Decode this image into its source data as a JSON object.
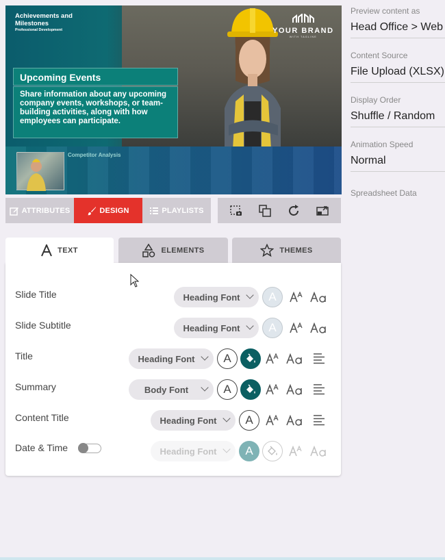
{
  "preview": {
    "header_title": "Achievements and Milestones",
    "header_subtitle": "Professional Development",
    "brand_name": "YOUR BRAND",
    "brand_tagline": "WITH TAGLINE",
    "event_title": "Upcoming Events",
    "event_body": "Share information about any upcoming company events, workshops, or team-building activities, along with how employees can participate.",
    "thumb_label": "Competitor Analysis"
  },
  "settings": {
    "preview_label": "Preview content as",
    "preview_value": "Head Office > Web",
    "source_label": "Content Source",
    "source_value": "File Upload (XLSX)",
    "order_label": "Display Order",
    "order_value": "Shuffle / Random",
    "speed_label": "Animation Speed",
    "speed_value": "Normal",
    "spreadsheet_label": "Spreadsheet Data"
  },
  "toolbar": {
    "attributes": "ATTRIBUTES",
    "design": "DESIGN",
    "playlists": "PLAYLISTS"
  },
  "tabs": {
    "text": "TEXT",
    "elements": "ELEMENTS",
    "themes": "THEMES"
  },
  "rows": {
    "slide_title": {
      "label": "Slide Title",
      "font": "Heading Font"
    },
    "slide_subtitle": {
      "label": "Slide Subtitle",
      "font": "Heading Font"
    },
    "title": {
      "label": "Title",
      "font": "Heading Font"
    },
    "summary": {
      "label": "Summary",
      "font": "Body Font"
    },
    "content_title": {
      "label": "Content Title",
      "font": "Heading Font"
    },
    "date_time": {
      "label": "Date & Time",
      "font": "Heading Font",
      "enabled": false
    }
  },
  "colors": {
    "accent": "#e4322b",
    "teal": "#0b5f62"
  }
}
